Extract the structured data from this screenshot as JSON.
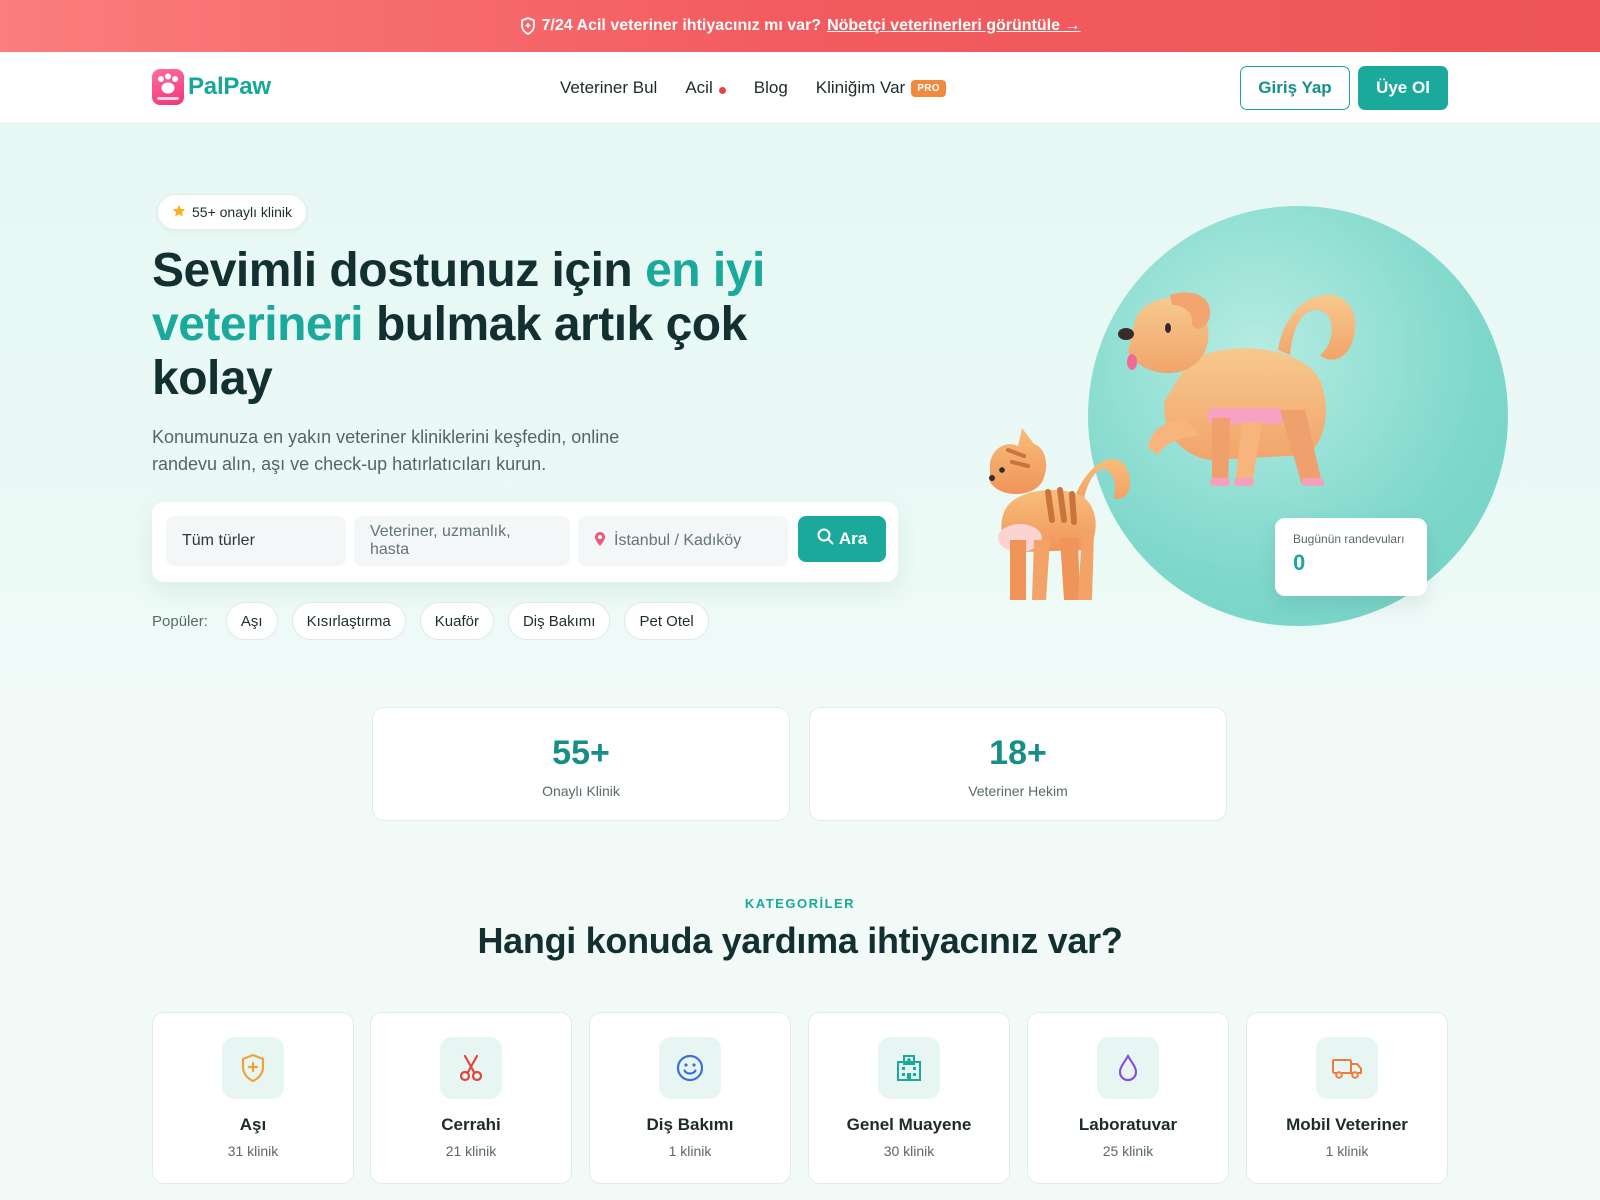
{
  "announcement": {
    "text": "7/24 Acil veteriner ihtiyacınız mı var?",
    "link": "Nöbetçi veterinerleri görüntüle →",
    "icon": "shield-icon"
  },
  "header": {
    "brand": "PalPaw",
    "nav": [
      {
        "label": "Veteriner Bul"
      },
      {
        "label": "Acil"
      },
      {
        "label": "Blog"
      },
      {
        "label": "Kliniğim Var",
        "badge": "PRO"
      }
    ],
    "login_label": "Giriş Yap",
    "register_label": "Üye Ol"
  },
  "hero": {
    "rating": "55+ onaylı klinik",
    "title_part1": "Sevimli dostunuz için ",
    "title_accent": "en iyi veterineri",
    "title_part2": " bulmak artık çok kolay",
    "subtitle": "Konumunuza en yakın veteriner kliniklerini keşfedin, online randevu alın, aşı ve check-up hatırlatıcıları kurun.",
    "search": {
      "type_value": "Tüm türler",
      "query_placeholder": "Veteriner, uzmanlık, hasta",
      "location_value": "İstanbul / Kadıköy",
      "button_label": "Ara"
    },
    "popular_label": "Popüler:",
    "popular": [
      "Aşı",
      "Kısırlaştırma",
      "Kuaför",
      "Diş Bakımı",
      "Pet Otel"
    ],
    "appointments_label": "Bugünün randevuları",
    "appointments_value": "0"
  },
  "stats": [
    {
      "value": "55+",
      "label": "Onaylı Klinik"
    },
    {
      "value": "18+",
      "label": "Veteriner Hekim"
    }
  ],
  "categories": {
    "eyebrow": "KATEGORİLER",
    "title": "Hangi konuda yardıma ihtiyacınız var?",
    "items": [
      {
        "name": "Aşı",
        "count": "31 klinik",
        "icon": "shield-plus-icon",
        "color": "#f0a23a",
        "bg": "#e8f6f3"
      },
      {
        "name": "Cerrahi",
        "count": "21 klinik",
        "icon": "scissors-icon",
        "color": "#e0453f",
        "bg": "#e8f6f3"
      },
      {
        "name": "Diş Bakımı",
        "count": "1 klinik",
        "icon": "smile-icon",
        "color": "#3b6fe0",
        "bg": "#e8f6f3"
      },
      {
        "name": "Genel Muayene",
        "count": "30 klinik",
        "icon": "hospital-icon",
        "color": "#1aa99b",
        "bg": "#e8f6f3"
      },
      {
        "name": "Laboratuvar",
        "count": "25 klinik",
        "icon": "droplet-icon",
        "color": "#8a4fd6",
        "bg": "#e8f6f3"
      },
      {
        "name": "Mobil Veteriner",
        "count": "1 klinik",
        "icon": "truck-icon",
        "color": "#f07a3a",
        "bg": "#e8f6f3"
      }
    ]
  },
  "colors": {
    "accent": "#1aa99b",
    "announcement": "#f25b5f",
    "pro": "#f08a3c"
  }
}
